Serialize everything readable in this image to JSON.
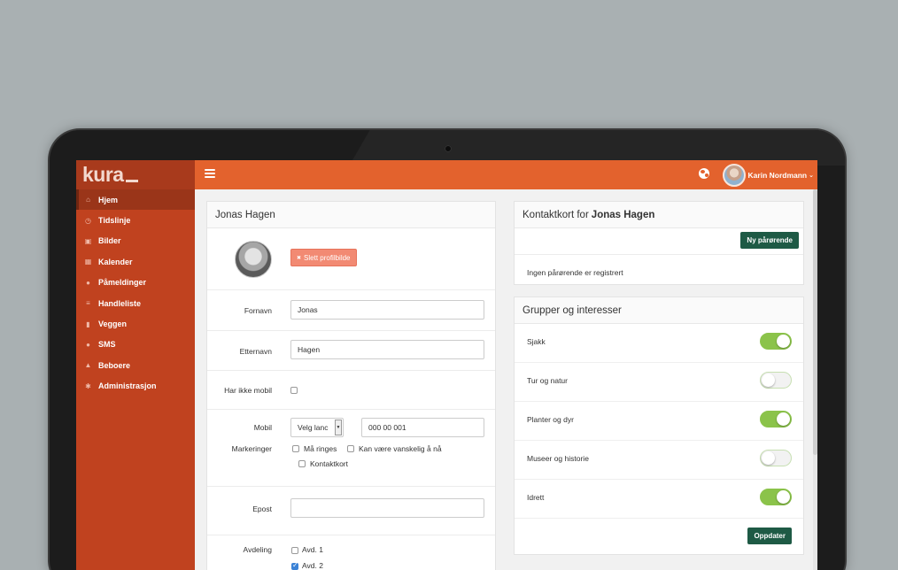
{
  "brand": {
    "name": "kura"
  },
  "sidebar": {
    "items": [
      {
        "label": "Hjem",
        "icon": "home-icon",
        "glyph": "⌂"
      },
      {
        "label": "Tidslinje",
        "icon": "clock-icon",
        "glyph": "◷"
      },
      {
        "label": "Bilder",
        "icon": "image-icon",
        "glyph": "▣"
      },
      {
        "label": "Kalender",
        "icon": "calendar-icon",
        "glyph": "▦"
      },
      {
        "label": "Påmeldinger",
        "icon": "users-icon",
        "glyph": "●"
      },
      {
        "label": "Handleliste",
        "icon": "list-icon",
        "glyph": "≡"
      },
      {
        "label": "Veggen",
        "icon": "microphone-icon",
        "glyph": "▮"
      },
      {
        "label": "SMS",
        "icon": "chat-icon",
        "glyph": "●"
      },
      {
        "label": "Beboere",
        "icon": "user-icon",
        "glyph": "▲"
      },
      {
        "label": "Administrasjon",
        "icon": "gear-icon",
        "glyph": "✱"
      }
    ]
  },
  "topbar": {
    "user_name": "Karin Nordmann",
    "chevron": "⌄"
  },
  "profile": {
    "title": "Jonas Hagen",
    "delete_photo_label": "Slett profilbilde",
    "delete_glyph": "✖",
    "first_name_label": "Fornavn",
    "first_name_value": "Jonas",
    "last_name_label": "Etternavn",
    "last_name_value": "Hagen",
    "no_mobile_label": "Har ikke mobil",
    "mobile_label": "Mobil",
    "country_select": "Velg lanc",
    "caret_glyph": "▼",
    "mobile_value": "000 00 001",
    "markings_label": "Markeringer",
    "markings": [
      "Må ringes",
      "Kan være vanskelig å nå",
      "Kontaktkort"
    ],
    "email_label": "Epost",
    "email_value": "",
    "department_label": "Avdeling",
    "departments": [
      {
        "label": "Avd. 1",
        "checked": false
      },
      {
        "label": "Avd. 2",
        "checked": true
      }
    ]
  },
  "contact": {
    "title_prefix": "Kontaktkort for",
    "title_name": "Jonas Hagen",
    "new_relative_label": "Ny pårørende",
    "empty_note": "Ingen pårørende er registrert"
  },
  "groups": {
    "title": "Grupper og interesser",
    "items": [
      {
        "label": "Sjakk",
        "on": true
      },
      {
        "label": "Tur og natur",
        "on": false
      },
      {
        "label": "Planter og dyr",
        "on": true
      },
      {
        "label": "Museer og historie",
        "on": false
      },
      {
        "label": "Idrett",
        "on": true
      }
    ],
    "update_label": "Oppdater"
  },
  "colors": {
    "topbar": "#e3622d",
    "sidebar": "#c0421f",
    "accent_green": "#1e5a45",
    "toggle_on": "#8bc34a"
  }
}
